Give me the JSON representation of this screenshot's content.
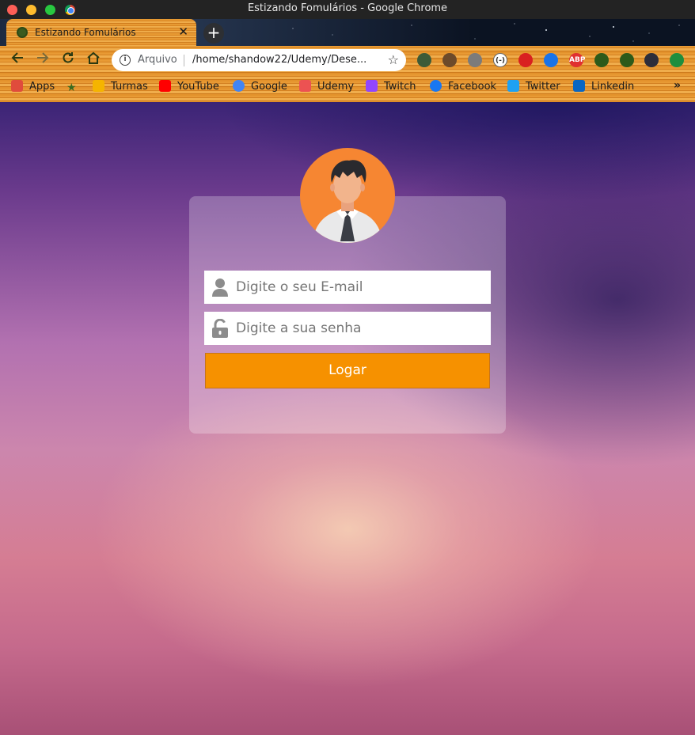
{
  "window": {
    "title": "Estizando Fomulários - Google Chrome"
  },
  "tab": {
    "title": "Estizando Fomulários",
    "close_glyph": "✕",
    "new_tab_glyph": "+"
  },
  "toolbar": {
    "scheme_label": "Arquivo",
    "url": "/home/shandow22/Udemy/Dese...",
    "icons": [
      "back-icon",
      "forward-icon",
      "reload-icon",
      "home-icon",
      "star-icon"
    ]
  },
  "extensions": [
    {
      "name": "spy-extension-icon",
      "color": "#3d5b38",
      "glyph": ""
    },
    {
      "name": "arrow-extension-icon",
      "color": "#6c4a2a",
      "glyph": ""
    },
    {
      "name": "gear-extension-icon",
      "color": "#7b7b7b",
      "glyph": ""
    },
    {
      "name": "circle-extension-icon",
      "color": "#ffffff",
      "glyph": "(-)"
    },
    {
      "name": "red-arrow-extension-icon",
      "color": "#d92020",
      "glyph": ""
    },
    {
      "name": "translate-extension-icon",
      "color": "#1a73e8",
      "glyph": ""
    },
    {
      "name": "adblock-extension-icon",
      "color": "#e03030",
      "glyph": "ABP"
    },
    {
      "name": "puzzle-extension-icon",
      "color": "#2d5a1a",
      "glyph": ""
    },
    {
      "name": "playlist-extension-icon",
      "color": "#2d5a1a",
      "glyph": ""
    },
    {
      "name": "profile-avatar-icon",
      "color": "#2d2d3a",
      "glyph": ""
    },
    {
      "name": "update-icon",
      "color": "#1e8e3e",
      "glyph": ""
    }
  ],
  "bookmarks": [
    {
      "label": "Apps",
      "icon": "apps-grid-icon",
      "color": "#e04c3c"
    },
    {
      "label": "",
      "icon": "star-bookmark-icon",
      "color": "#3a6a1e"
    },
    {
      "label": "Turmas",
      "icon": "classroom-icon",
      "color": "#f5b400"
    },
    {
      "label": "YouTube",
      "icon": "youtube-icon",
      "color": "#ff0000"
    },
    {
      "label": "Google",
      "icon": "google-icon",
      "color": "#4285f4"
    },
    {
      "label": "Udemy",
      "icon": "udemy-icon",
      "color": "#ec5252"
    },
    {
      "label": "Twitch",
      "icon": "twitch-icon",
      "color": "#9146ff"
    },
    {
      "label": "Facebook",
      "icon": "facebook-icon",
      "color": "#1877f2"
    },
    {
      "label": "Twitter",
      "icon": "twitter-icon",
      "color": "#1da1f2"
    },
    {
      "label": "Linkedin",
      "icon": "linkedin-icon",
      "color": "#0a66c2"
    }
  ],
  "bookmarks_overflow": "»",
  "login": {
    "email_placeholder": "Digite o seu E-mail",
    "password_placeholder": "Digite a sua senha",
    "button_label": "Logar",
    "accent_color": "#f69100",
    "avatar_bg": "#f68632"
  }
}
